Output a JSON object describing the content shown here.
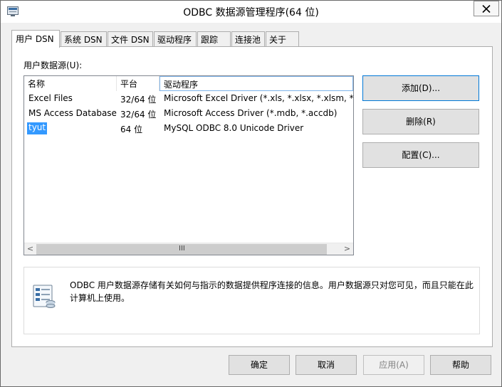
{
  "window": {
    "title": "ODBC 数据源管理程序(64 位)"
  },
  "tabs": [
    {
      "label": "用户 DSN"
    },
    {
      "label": "系统 DSN"
    },
    {
      "label": "文件 DSN"
    },
    {
      "label": "驱动程序"
    },
    {
      "label": "跟踪"
    },
    {
      "label": "连接池"
    },
    {
      "label": "关于"
    }
  ],
  "user_dsn": {
    "section_label": "用户数据源(U):",
    "columns": [
      "名称",
      "平台",
      "驱动程序"
    ],
    "rows": [
      {
        "name": "Excel Files",
        "platform": "32/64 位",
        "driver": "Microsoft Excel Driver (*.xls, *.xlsx, *.xlsm, *.xlsb)"
      },
      {
        "name": "MS Access Database",
        "platform": "32/64 位",
        "driver": "Microsoft Access Driver (*.mdb, *.accdb)"
      },
      {
        "name": "tyut",
        "platform": "64 位",
        "driver": "MySQL ODBC 8.0 Unicode Driver"
      }
    ],
    "selected_row": 2,
    "scroll_left": "<",
    "scroll_right": ">",
    "scroll_grip": "III",
    "buttons": {
      "add": "添加(D)...",
      "remove": "删除(R)",
      "configure": "配置(C)..."
    },
    "info_text": "ODBC 用户数据源存储有关如何与指示的数据提供程序连接的信息。用户数据源只对您可见，而且只能在此计算机上使用。"
  },
  "footer": {
    "ok": "确定",
    "cancel": "取消",
    "apply": "应用(A)",
    "help": "帮助"
  },
  "icons": {
    "title_icon": "odbc-admin-icon",
    "close": "close-icon",
    "info": "data-source-icon"
  },
  "colors": {
    "selection": "#3399ff",
    "focus_border": "#0078d7"
  }
}
